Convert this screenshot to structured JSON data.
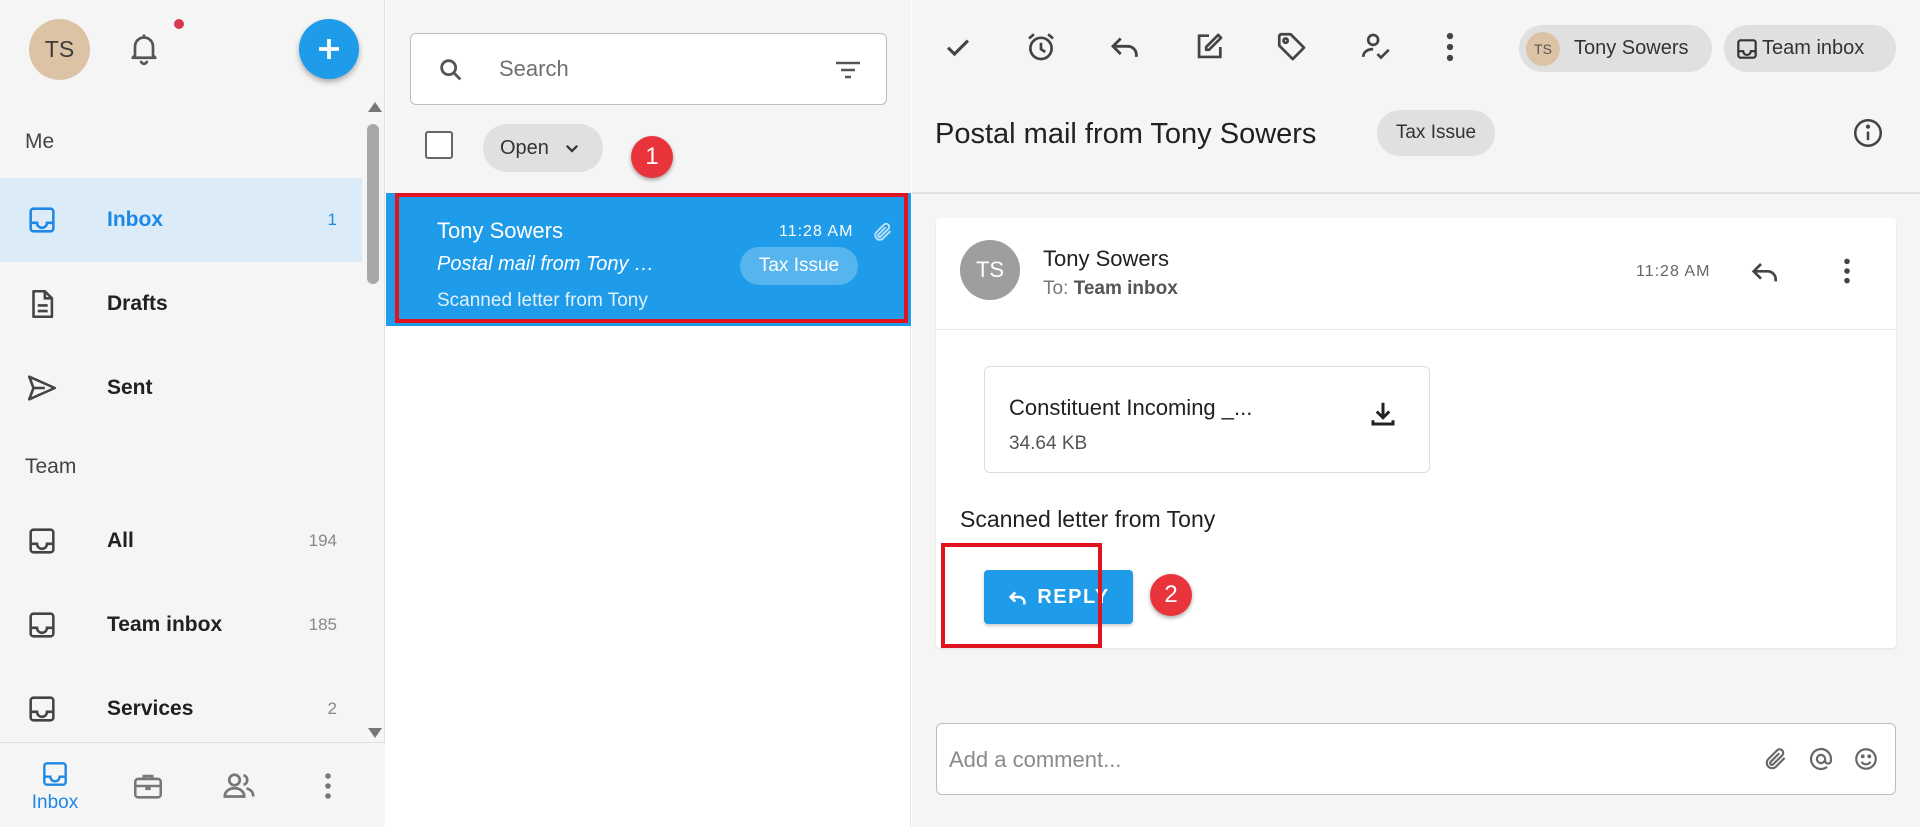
{
  "user": {
    "initials": "TS"
  },
  "sidebar": {
    "section_me": "Me",
    "section_team": "Team",
    "me_items": [
      {
        "label": "Inbox",
        "count": "1"
      },
      {
        "label": "Drafts",
        "count": ""
      },
      {
        "label": "Sent",
        "count": ""
      }
    ],
    "team_items": [
      {
        "label": "All",
        "count": "194"
      },
      {
        "label": "Team inbox",
        "count": "185"
      },
      {
        "label": "Services",
        "count": "2"
      }
    ]
  },
  "bottom_nav": {
    "inbox_label": "Inbox"
  },
  "list": {
    "search_placeholder": "Search",
    "filter_label": "Open",
    "thread": {
      "sender": "Tony Sowers",
      "time": "11:28 AM",
      "subject": "Postal mail from Tony Sowers",
      "tag": "Tax Issue",
      "preview": "Scanned letter from Tony"
    }
  },
  "detail": {
    "assignee": "Tony Sowers",
    "assignee_initials": "TS",
    "inbox_chip": "Team inbox",
    "title": "Postal mail from Tony Sowers",
    "title_tag": "Tax Issue",
    "message": {
      "initials": "TS",
      "from": "Tony Sowers",
      "to_label": "To:",
      "to_value": "Team inbox",
      "time": "11:28 AM",
      "attachment_name": "Constituent Incoming _...",
      "attachment_size": "34.64 KB",
      "body": "Scanned letter from Tony",
      "reply_label": "REPLY"
    },
    "comment_placeholder": "Add a comment..."
  },
  "markers": {
    "first": "1",
    "second": "2"
  },
  "colors": {
    "accent": "#1e9be9",
    "highlight": "#e0141e",
    "marker": "#e8343a"
  }
}
